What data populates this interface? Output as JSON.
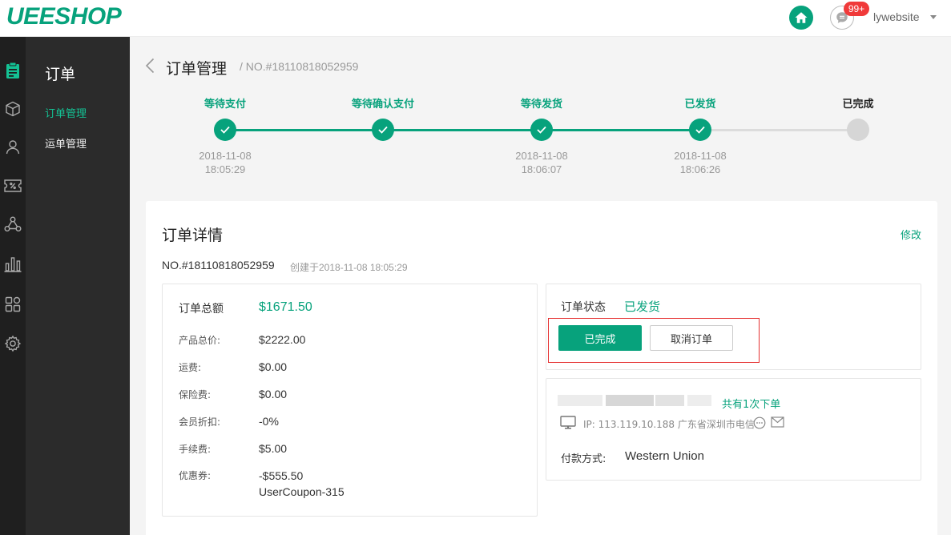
{
  "brand": {
    "logo_text": "UEESHOP",
    "accent": "#07a27c"
  },
  "header": {
    "home_icon": "home-icon",
    "message_icon": "chat-bubble-icon",
    "message_badge": "99+",
    "username": "lywebsite"
  },
  "iconbar": {
    "items": [
      "clipboard-icon",
      "box-icon",
      "user-icon",
      "coupon-icon",
      "share-network-icon",
      "bar-chart-icon",
      "apps-grid-icon",
      "gear-icon"
    ]
  },
  "subnav": {
    "title": "订单",
    "items": [
      {
        "label": "订单管理",
        "active": true
      },
      {
        "label": "运单管理",
        "active": false
      }
    ]
  },
  "page": {
    "title": "订单管理",
    "subtitle": "/ NO.#18110818052959"
  },
  "steps": [
    {
      "label": "等待支付",
      "date": "2018-11-08",
      "time": "18:05:29",
      "done": true
    },
    {
      "label": "等待确认支付",
      "date": "",
      "time": "",
      "done": true
    },
    {
      "label": "等待发货",
      "date": "2018-11-08",
      "time": "18:06:07",
      "done": true
    },
    {
      "label": "已发货",
      "date": "2018-11-08",
      "time": "18:06:26",
      "done": true
    },
    {
      "label": "已完成",
      "date": "",
      "time": "",
      "done": false
    }
  ],
  "details": {
    "title": "订单详情",
    "edit_label": "修改",
    "order_no": "NO.#18110818052959",
    "created": "创建于2018-11-08 18:05:29"
  },
  "amounts": {
    "total_label": "订单总额",
    "total_value": "$1671.50",
    "rows": [
      {
        "label": "产品总价:",
        "value": "$2222.00"
      },
      {
        "label": "运费:",
        "value": "$0.00"
      },
      {
        "label": "保险费:",
        "value": "$0.00"
      },
      {
        "label": "会员折扣:",
        "value": "-0%"
      },
      {
        "label": "手续费:",
        "value": "$5.00"
      },
      {
        "label": "优惠券:",
        "value": "-$555.50",
        "sub": "UserCoupon-315"
      }
    ]
  },
  "status": {
    "label": "订单状态",
    "value": "已发货",
    "complete_button": "已完成",
    "cancel_button": "取消订单"
  },
  "customer": {
    "order_count": "共有1次下单",
    "ip": "IP: 113.119.10.188 广东省深圳市电信",
    "payment_label": "付款方式:",
    "payment_value": "Western Union"
  }
}
